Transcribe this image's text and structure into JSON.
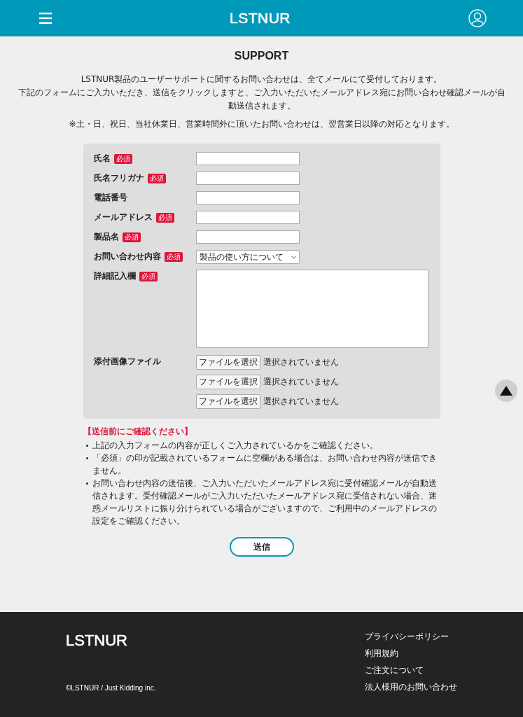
{
  "header": {
    "logo": "LSTNUR"
  },
  "page_title": "SUPPORT",
  "intro": [
    "LSTNUR製品のユーザーサポートに関するお問い合わせは、全てメールにて受付しております。",
    "下記のフォームにご入力いただき、送信をクリックしますと、ご入力いただいたメールアドレス宛にお問い合わせ確認メールが自動送信されます。"
  ],
  "notice": "※土・日、祝日、当社休業日、営業時間外に頂いたお問い合わせは、翌営業日以降の対応となります。",
  "form": {
    "fields": [
      {
        "kind": "text",
        "label": "氏名",
        "badge": "必須"
      },
      {
        "kind": "text",
        "label": "氏名フリガナ",
        "badge": "必須"
      },
      {
        "kind": "text",
        "label": "電話番号"
      },
      {
        "kind": "text",
        "label": "メールアドレス",
        "badge": "必須"
      },
      {
        "kind": "text",
        "label": "製品名",
        "badge": "必須"
      },
      {
        "kind": "select",
        "label": "お問い合わせ内容",
        "badge": "必須",
        "value": "製品の使い方について"
      },
      {
        "kind": "textarea",
        "label": "詳細記入欄",
        "badge": "必須"
      },
      {
        "kind": "file",
        "label": "添付画像ファイル",
        "files": [
          {
            "button": "ファイルを選択",
            "status": "選択されていません"
          },
          {
            "button": "ファイルを選択",
            "status": "選択されていません"
          },
          {
            "button": "ファイルを選択",
            "status": "選択されていません"
          }
        ]
      }
    ]
  },
  "confirm": {
    "heading": "【送信前にご確認ください】",
    "items": [
      "上記の入力フォームの内容が正しくご入力されているかをご確認ください。",
      "「必須」の印が記載されているフォームに空欄がある場合は、お問い合わせ内容が送信できません。",
      "お問い合わせ内容の送信後、ご入力いただいたメールアドレス宛に受付確認メールが自動送信されます。受付確認メールがご入力いただいたメールアドレス宛に受信されない場合、迷惑メールリストに振り分けられている場合がございますので、ご利用中のメールアドレスの設定をご確認ください。"
    ]
  },
  "submit_button": "送信",
  "footer": {
    "logo": "LSTNUR",
    "copyright": "©LSTNUR / Just Kidding inc.",
    "links": [
      "プライバシーポリシー",
      "利用規約",
      "ご注文について",
      "法人様用のお問い合わせ"
    ]
  }
}
